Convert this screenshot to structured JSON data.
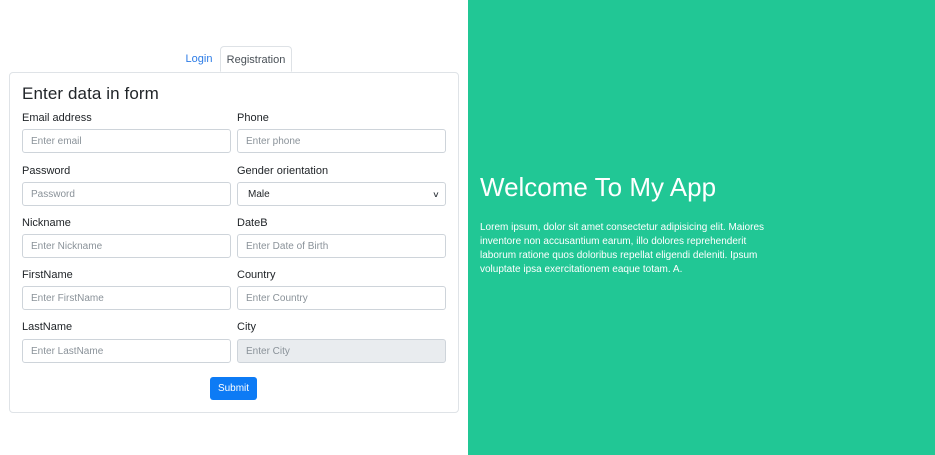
{
  "tabs": [
    {
      "label": "Login"
    },
    {
      "label": "Registration"
    }
  ],
  "form": {
    "title": "Enter data in form",
    "fields": {
      "email": {
        "label": "Email address",
        "placeholder": "Enter email"
      },
      "phone": {
        "label": "Phone",
        "placeholder": "Enter phone"
      },
      "password": {
        "label": "Password",
        "placeholder": "Password"
      },
      "gender": {
        "label": "Gender orientation",
        "value": "Male"
      },
      "nickname": {
        "label": "Nickname",
        "placeholder": "Enter Nickname"
      },
      "dateb": {
        "label": "DateB",
        "placeholder": "Enter Date of Birth"
      },
      "firstname": {
        "label": "FirstName",
        "placeholder": "Enter FirstName"
      },
      "country": {
        "label": "Country",
        "placeholder": "Enter Country"
      },
      "lastname": {
        "label": "LastName",
        "placeholder": "Enter LastName"
      },
      "city": {
        "label": "City",
        "placeholder": "Enter City"
      }
    },
    "submit_label": "Submit"
  },
  "hero": {
    "title": "Welcome To My App",
    "text": "Lorem ipsum, dolor sit amet consectetur adipisicing elit. Maiores inventore non accusantium earum, illo dolores reprehenderit laborum ratione quos doloribus repellat eligendi deleniti. Ipsum voluptate ipsa exercitationem eaque totam. A."
  },
  "colors": {
    "accent": "#21c795",
    "primary_button": "#0d7bf5",
    "link": "#2d7ce6"
  },
  "icons": {
    "select_chevron": "chevron-down-icon"
  }
}
